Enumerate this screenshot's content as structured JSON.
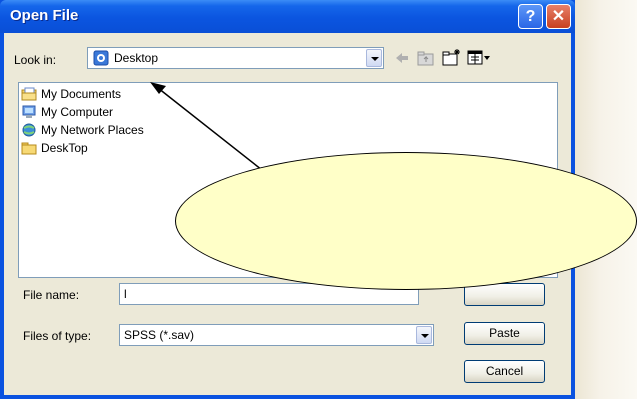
{
  "window": {
    "title": "Open File",
    "help_glyph": "?",
    "close_glyph": "✕"
  },
  "lookin": {
    "label": "Look in:",
    "value": "Desktop"
  },
  "toolbar": {
    "icons": [
      "back-arrow-icon",
      "up-folder-icon",
      "new-folder-icon",
      "view-menu-icon"
    ]
  },
  "files": [
    {
      "name": "My Documents",
      "icon": "my-documents-icon"
    },
    {
      "name": "My Computer",
      "icon": "my-computer-icon"
    },
    {
      "name": "My Network Places",
      "icon": "network-places-icon"
    },
    {
      "name": "DeskTop",
      "icon": "folder-icon"
    }
  ],
  "filename": {
    "label": "File name:",
    "value": "l"
  },
  "filetype": {
    "label": "Files of type:",
    "value": "SPSS (*.sav)"
  },
  "buttons": {
    "paste": "Paste",
    "cancel": "Cancel"
  },
  "colors": {
    "titlebar": "#0a52e0",
    "balloon": "#ffffc8",
    "close": "#c84020"
  }
}
